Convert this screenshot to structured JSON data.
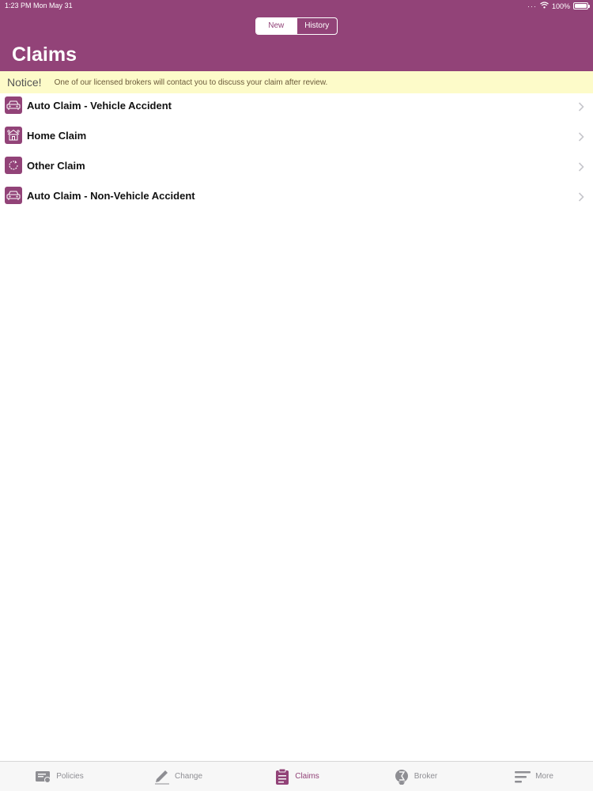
{
  "status_bar": {
    "time": "1:23 PM",
    "date": "Mon May 31",
    "battery": "100%"
  },
  "segmented": {
    "new_label": "New",
    "history_label": "History"
  },
  "page": {
    "title": "Claims"
  },
  "notice": {
    "label": "Notice!",
    "text": "One of our licensed brokers will contact you to discuss your claim after review."
  },
  "claims": [
    {
      "label": "Auto Claim - Vehicle Accident",
      "icon": "car-icon"
    },
    {
      "label": "Home Claim",
      "icon": "home-icon"
    },
    {
      "label": "Other Claim",
      "icon": "refresh-icon"
    },
    {
      "label": "Auto Claim - Non-Vehicle Accident",
      "icon": "car-icon"
    }
  ],
  "tabs": [
    {
      "label": "Policies",
      "icon": "policy-icon",
      "active": false
    },
    {
      "label": "Change",
      "icon": "pencil-icon",
      "active": false
    },
    {
      "label": "Claims",
      "icon": "clipboard-icon",
      "active": true
    },
    {
      "label": "Broker",
      "icon": "broker-icon",
      "active": false
    },
    {
      "label": "More",
      "icon": "menu-icon",
      "active": false
    }
  ],
  "colors": {
    "brand": "#924378",
    "notice_bg": "#fdfbc9",
    "tab_inactive": "#8e8e93"
  }
}
